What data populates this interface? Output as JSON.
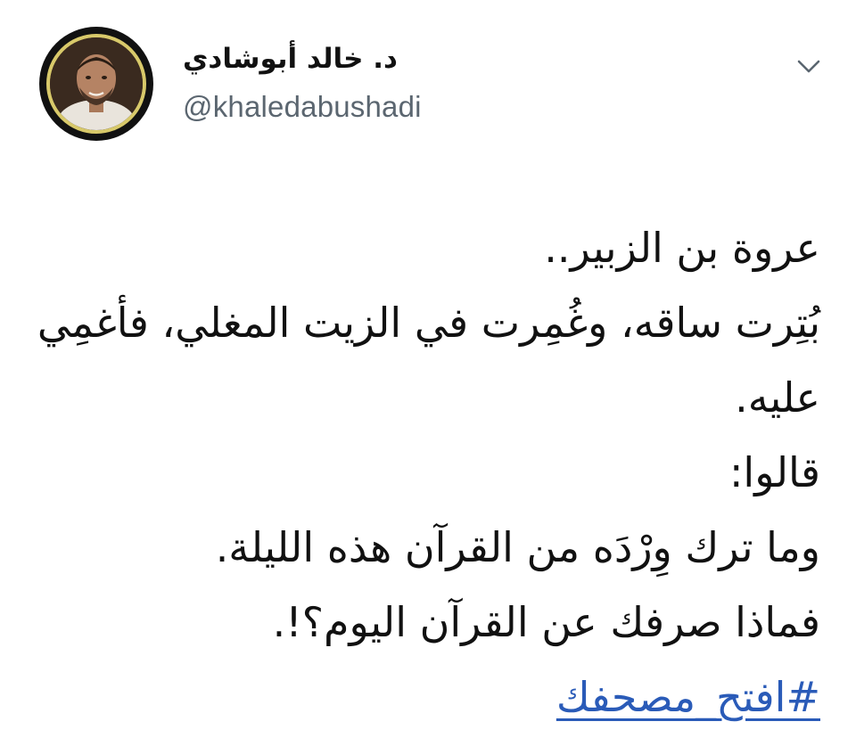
{
  "author": {
    "display_name": "د. خالد أبوشادي",
    "handle": "@khaledabushadi",
    "avatar_icon": "profile-photo"
  },
  "menu_icon": "chevron-down-icon",
  "tweet": {
    "lines": [
      "عروة بن الزبير..",
      "بُتِرت ساقه، وغُمِرت في الزيت المغلي، فأغمِي",
      "عليه.",
      "قالوا:",
      "وما ترك وِرْدَه من القرآن هذه الليلة.",
      "فماذا صرفك عن القرآن اليوم؟!."
    ],
    "hashtag": "#افتح_مصحفك"
  },
  "colors": {
    "link": "#2a5bb8",
    "handle": "#5b6670",
    "text": "#111111",
    "avatar_ring": "#d8c96a"
  }
}
